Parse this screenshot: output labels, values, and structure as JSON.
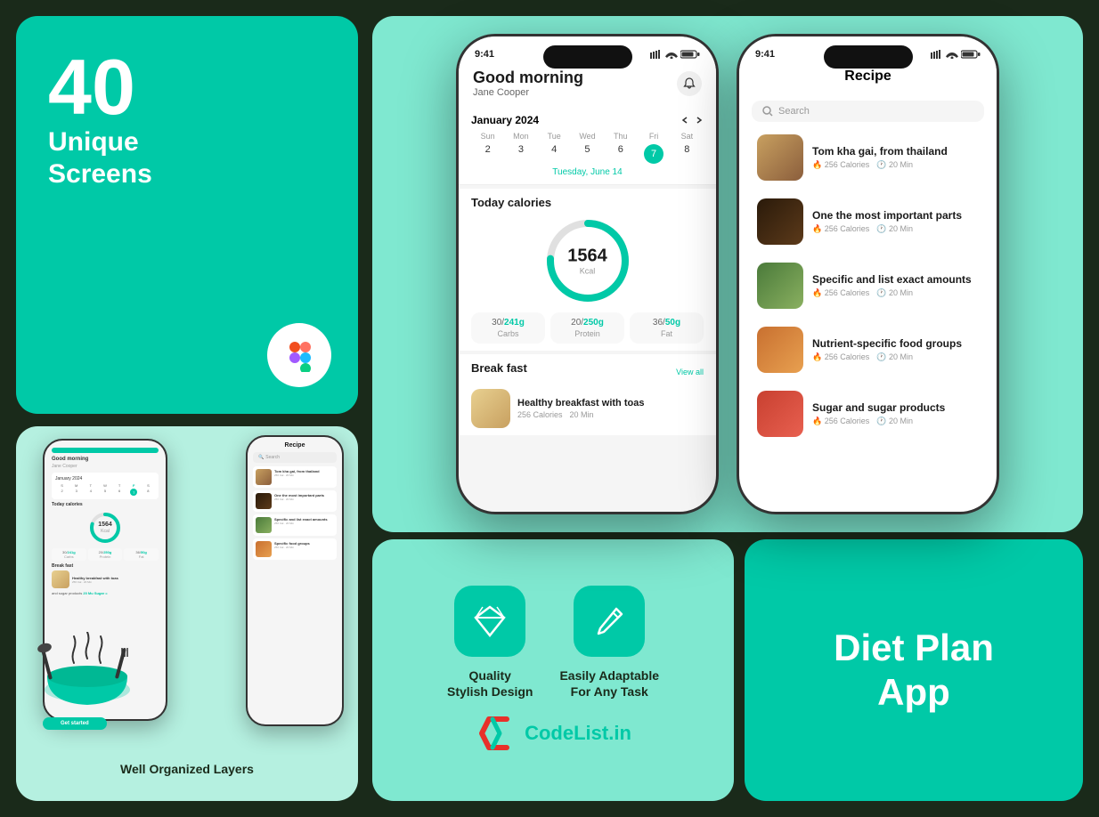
{
  "card40": {
    "number": "40",
    "label": "Unique\nScreens"
  },
  "cardLayers": {
    "label": "Well Organized Layers"
  },
  "phoneDashboard": {
    "time": "9:41",
    "greeting": "Good morning",
    "userName": "Jane Cooper",
    "month": "January 2024",
    "dayHeaders": [
      "Sun",
      "Mon",
      "Tue",
      "Wed",
      "Thu",
      "Fri",
      "Sat"
    ],
    "days": [
      "2",
      "3",
      "4",
      "5",
      "6",
      "7",
      "8"
    ],
    "activeDay": "7",
    "todayLabel": "Tuesday, June 14",
    "caloriesSection": "Today calories",
    "calorieNum": "1564",
    "calorieUnit": "Kcal",
    "macros": [
      {
        "current": "30",
        "total": "241g",
        "label": "Carbs"
      },
      {
        "current": "20",
        "total": "250g",
        "label": "Protein"
      },
      {
        "current": "36",
        "total": "50g",
        "label": "Fat"
      }
    ],
    "breakfastTitle": "Break fast",
    "viewAll": "View all",
    "breakfastItem": {
      "name": "Healthy breakfast with toas",
      "calories": "256 Calories",
      "time": "20 Min"
    }
  },
  "phoneRecipe": {
    "time": "9:41",
    "title": "Recipe",
    "searchPlaceholder": "Search",
    "recipes": [
      {
        "name": "Tom kha gai, from thailand",
        "calories": "256 Calories",
        "time": "20 Min",
        "colorClass": "food-thai"
      },
      {
        "name": "One the most important parts",
        "calories": "256 Calories",
        "time": "20 Min",
        "colorClass": "food-dark"
      },
      {
        "name": "Specific and list exact amounts",
        "calories": "256 Calories",
        "time": "20 Min",
        "colorClass": "food-green"
      },
      {
        "name": "Nutrient-specific food groups",
        "calories": "256 Calories",
        "time": "20 Min",
        "colorClass": "food-orange"
      },
      {
        "name": "Sugar and sugar products",
        "calories": "256 Calories",
        "time": "20 Min",
        "colorClass": "food-red"
      }
    ]
  },
  "features": [
    {
      "iconType": "diamond",
      "label": "Quality\nStylish Design"
    },
    {
      "iconType": "pencil",
      "label": "Easily Adaptable\nFor Any  Task"
    }
  ],
  "codelist": {
    "text": "CodeList.in"
  },
  "dietPlan": {
    "label": "Diet Plan\nApp"
  }
}
